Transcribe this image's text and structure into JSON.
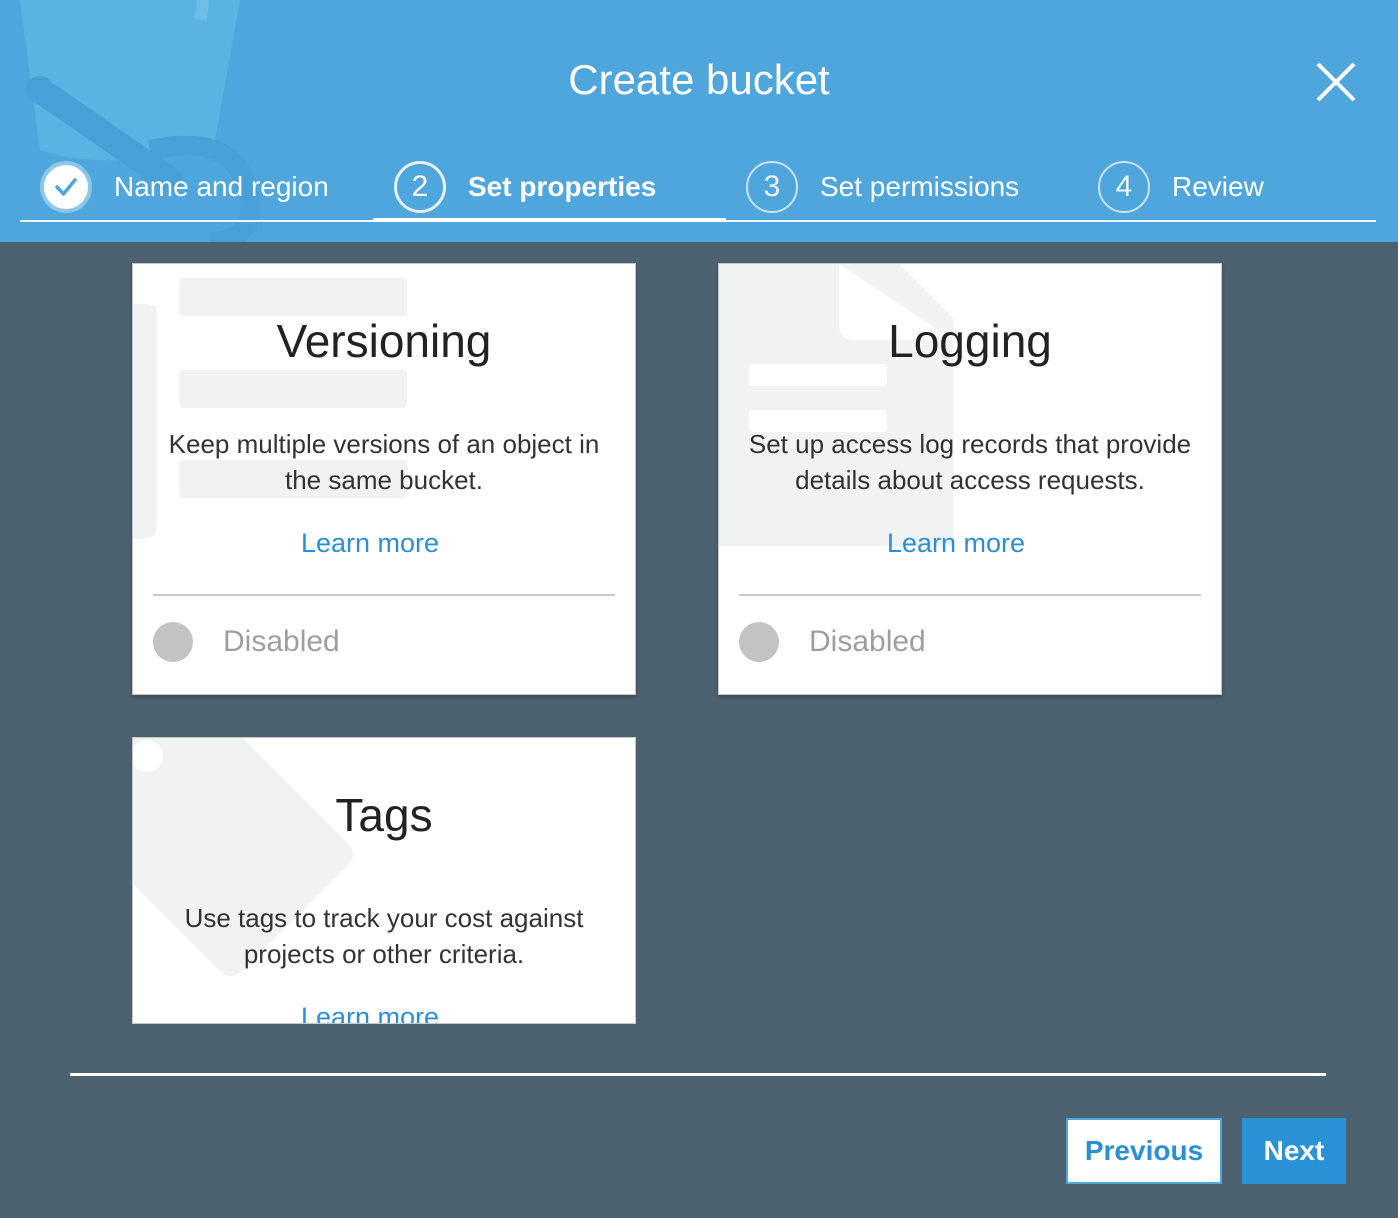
{
  "dialog": {
    "title": "Create bucket",
    "accent_color": "#4fa6dc"
  },
  "steps": [
    {
      "number": "",
      "label": "Name and region",
      "state": "complete",
      "icon": "check-icon"
    },
    {
      "number": "2",
      "label": "Set properties",
      "state": "active"
    },
    {
      "number": "3",
      "label": "Set permissions",
      "state": "upcoming"
    },
    {
      "number": "4",
      "label": "Review",
      "state": "upcoming"
    }
  ],
  "cards": {
    "versioning": {
      "title": "Versioning",
      "description_line1": "Keep multiple versions of an object in",
      "description_line2": "the same bucket.",
      "learn_more": "Learn more",
      "status": "Disabled"
    },
    "logging": {
      "title": "Logging",
      "description_line1": "Set up access log records that provide",
      "description_line2": "details about access requests.",
      "learn_more": "Learn more",
      "status": "Disabled"
    },
    "tags": {
      "title": "Tags",
      "description_line1": "Use tags to track your cost against",
      "description_line2": "projects or other criteria.",
      "learn_more": "Learn more"
    }
  },
  "footer": {
    "previous_label": "Previous",
    "next_label": "Next"
  }
}
